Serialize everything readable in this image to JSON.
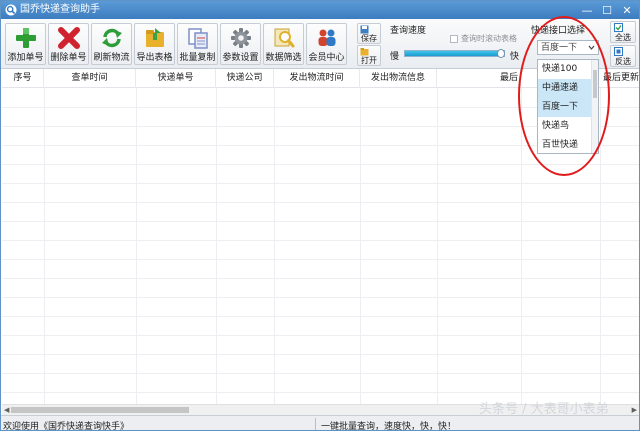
{
  "window": {
    "title": "国乔快递查询助手",
    "min_glyph": "—",
    "max_glyph": "☐",
    "close_glyph": "✕"
  },
  "toolbar": {
    "buttons": [
      {
        "id": "add",
        "label": "添加单号",
        "icon": "plus-icon",
        "color": "#2e9d33"
      },
      {
        "id": "delete",
        "label": "删除单号",
        "icon": "x-icon",
        "color": "#cf2330"
      },
      {
        "id": "refresh",
        "label": "刷新物流",
        "icon": "refresh-icon",
        "color": "#2f9e3a"
      },
      {
        "id": "export",
        "label": "导出表格",
        "icon": "export-folder-icon",
        "color": "#e8b02b"
      },
      {
        "id": "batch-copy",
        "label": "批量复制",
        "icon": "copy-icon",
        "color": "#7e8fc7"
      },
      {
        "id": "settings",
        "label": "参数设置",
        "icon": "gear-icon",
        "color": "#7a7f86"
      },
      {
        "id": "filter",
        "label": "数据筛选",
        "icon": "filter-icon",
        "color": "#e2b12a"
      },
      {
        "id": "member",
        "label": "会员中心",
        "icon": "members-icon",
        "color": "#d1432f"
      }
    ],
    "save_label": "保存",
    "open_label": "打开"
  },
  "speed": {
    "label": "查询速度",
    "scroll_checkbox_label": "查询时滚动表格",
    "scroll_checked": false,
    "slow_label": "慢",
    "fast_label": "快",
    "level": 0.96
  },
  "api": {
    "label": "快递接口选择",
    "selected": "百度一下",
    "options": [
      "快递100",
      "中通速递",
      "百度一下",
      "快递鸟",
      "百世快递"
    ],
    "highlighted": [
      "中通速递",
      "百度一下"
    ]
  },
  "side_buttons": {
    "select_all": "全选",
    "invert": "反选"
  },
  "table": {
    "columns": [
      "序号",
      "查单时间",
      "快递单号",
      "快递公司",
      "发出物流时间",
      "发出物流信息",
      "最后",
      "最后更新物流"
    ],
    "rows": []
  },
  "status": {
    "left": "欢迎使用《国乔快递查询快手》",
    "center": "一键批量查询，速度快，快，快！"
  },
  "watermark": "头条号 / 大表哥小表弟",
  "colors": {
    "titlebar": "#4a8ccc",
    "annotation": "#e11b1b",
    "highlight": "#cbe6f7"
  }
}
